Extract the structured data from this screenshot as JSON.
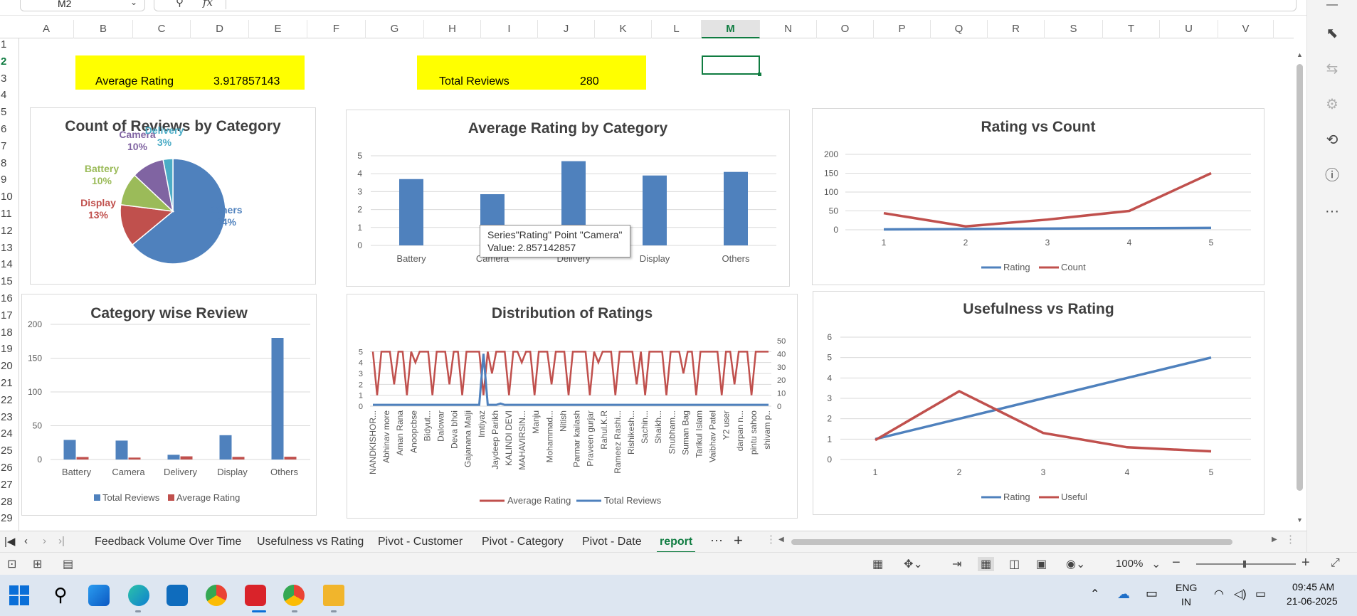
{
  "formula_bar": {
    "name_box": "M2",
    "fx_label": "fx",
    "formula": ""
  },
  "columns": [
    "A",
    "B",
    "C",
    "D",
    "E",
    "F",
    "G",
    "H",
    "I",
    "J",
    "K",
    "L",
    "M",
    "N",
    "O",
    "P",
    "Q",
    "R",
    "S",
    "T",
    "U",
    "V"
  ],
  "selected_column": "M",
  "rows": [
    "1",
    "2",
    "3",
    "4",
    "5",
    "6",
    "7",
    "8",
    "9",
    "10",
    "11",
    "12",
    "13",
    "14",
    "15",
    "16",
    "17",
    "18",
    "19",
    "20",
    "21",
    "22",
    "23",
    "24",
    "25",
    "26",
    "27",
    "28",
    "29"
  ],
  "selected_row": "2",
  "kpi": {
    "avg_rating_label": "Average Rating",
    "avg_rating_value": "3.917857143",
    "total_reviews_label": "Total Reviews",
    "total_reviews_value": "280"
  },
  "charts": {
    "pie": {
      "title": "Count of Reviews by Category",
      "labels": [
        {
          "name": "Others",
          "pct": "64%",
          "color": "#4f81bd"
        },
        {
          "name": "Display",
          "pct": "13%",
          "color": "#c0504d"
        },
        {
          "name": "Battery",
          "pct": "10%",
          "color": "#9bbb59"
        },
        {
          "name": "Camera",
          "pct": "10%",
          "color": "#8064a2"
        },
        {
          "name": "Delivery",
          "pct": "3%",
          "color": "#4bacc6"
        }
      ]
    },
    "avg_bar": {
      "title": "Average Rating by Category",
      "tooltip_line1": "Series\"Rating\" Point \"Camera\"",
      "tooltip_line2": "Value: 2.857142857"
    },
    "rating_count": {
      "title": "Rating vs Count",
      "legend": [
        "Rating",
        "Count"
      ]
    },
    "category_review": {
      "title": "Category wise Review",
      "legend": [
        "Total Reviews",
        "Average Rating"
      ]
    },
    "distribution": {
      "title": "Distribution of Ratings",
      "legend": [
        "Average Rating",
        "Total Reviews"
      ],
      "x_labels": [
        "NANDKISHOR...",
        "Abhinav more",
        "Aman Rana",
        "Anoopcbse",
        "Bidyut...",
        "Dalowar",
        "Deva bhoi",
        "Gajanana Malji",
        "Imtiyaz",
        "Jaydeep Parikh",
        "KALINDI DEVI",
        "MAHAVIRSIN...",
        "Manju",
        "Mohammad...",
        "Nitish",
        "Parmar kailash",
        "Praveen gurjar",
        "Rahul.K.R",
        "Rameez Rashi...",
        "Rishikesh...",
        "Sachin...",
        "Shaikh...",
        "Shubham...",
        "Suman Bag",
        "Tarikul Islam",
        "Vaibhav Patel",
        "Y2 user",
        "darpan n...",
        "pintu sahoo",
        "shivam p.."
      ]
    },
    "usefulness": {
      "title": "Usefulness vs Rating",
      "legend": [
        "Rating",
        "Useful"
      ]
    }
  },
  "chart_data": [
    {
      "type": "pie",
      "title": "Count of Reviews by Category",
      "categories": [
        "Others",
        "Display",
        "Battery",
        "Camera",
        "Delivery"
      ],
      "values": [
        64,
        13,
        10,
        10,
        3
      ]
    },
    {
      "type": "bar",
      "title": "Average Rating by Category",
      "categories": [
        "Battery",
        "Camera",
        "Delivery",
        "Display",
        "Others"
      ],
      "values": [
        3.7,
        2.857142857,
        4.7,
        3.9,
        4.1
      ],
      "ylim": [
        0,
        5
      ]
    },
    {
      "type": "line",
      "title": "Rating vs Count",
      "x": [
        1,
        2,
        3,
        4,
        5
      ],
      "series": [
        {
          "name": "Rating",
          "values": [
            1,
            2,
            3,
            4,
            5
          ]
        },
        {
          "name": "Count",
          "values": [
            44,
            9,
            27,
            50,
            150
          ]
        }
      ],
      "ylim": [
        0,
        200
      ]
    },
    {
      "type": "bar",
      "title": "Category wise Review",
      "categories": [
        "Battery",
        "Camera",
        "Delivery",
        "Display",
        "Others"
      ],
      "series": [
        {
          "name": "Total Reviews",
          "values": [
            29,
            28,
            7,
            36,
            180
          ]
        },
        {
          "name": "Average Rating",
          "values": [
            3.7,
            2.857142857,
            4.7,
            3.9,
            4.1
          ]
        }
      ],
      "ylim": [
        0,
        200
      ]
    },
    {
      "type": "line",
      "title": "Distribution of Ratings",
      "series": [
        {
          "name": "Average Rating",
          "values": [
            5,
            1,
            5,
            5,
            5,
            2,
            5,
            5,
            1,
            5,
            4,
            5,
            5,
            5,
            1,
            5,
            5,
            5,
            2,
            5,
            5,
            1,
            5,
            5,
            5,
            5,
            1,
            5,
            3,
            5,
            5,
            5,
            1,
            5,
            5,
            4,
            5,
            5,
            1,
            5,
            5,
            5,
            2,
            5,
            5,
            5,
            1,
            5,
            5,
            5,
            5,
            1,
            5,
            4,
            5,
            5,
            5,
            1,
            5,
            5,
            5,
            5,
            2,
            5,
            1,
            5,
            5,
            5,
            5,
            1,
            5,
            5,
            5,
            3,
            5,
            5,
            1,
            5,
            5,
            5,
            5,
            5,
            1,
            5,
            5,
            2,
            5,
            5,
            5,
            1,
            5,
            5,
            5,
            5
          ]
        },
        {
          "name": "Total Reviews",
          "values": [
            1,
            1,
            1,
            1,
            1,
            1,
            1,
            1,
            1,
            1,
            1,
            1,
            1,
            1,
            1,
            1,
            1,
            1,
            1,
            1,
            1,
            1,
            1,
            1,
            1,
            1,
            40,
            1,
            1,
            1,
            2,
            1,
            1,
            1,
            1,
            1,
            1,
            1,
            1,
            1,
            1,
            1,
            1,
            1,
            1,
            1,
            1,
            1,
            1,
            1,
            1,
            1,
            1,
            1,
            1,
            1,
            1,
            1,
            1,
            1,
            1,
            1,
            1,
            1,
            1,
            1,
            1,
            1,
            1,
            1,
            1,
            1,
            1,
            1,
            1,
            1,
            1,
            1,
            1,
            1,
            1,
            1,
            1,
            1,
            1,
            1,
            1,
            1,
            1,
            1,
            1,
            1,
            1,
            1
          ]
        }
      ],
      "ylim": [
        0,
        6
      ],
      "y2lim": [
        0,
        50
      ]
    },
    {
      "type": "line",
      "title": "Usefulness vs Rating",
      "x": [
        1,
        2,
        3,
        4,
        5
      ],
      "series": [
        {
          "name": "Rating",
          "values": [
            1,
            2,
            3,
            4,
            5
          ]
        },
        {
          "name": "Useful",
          "values": [
            0.95,
            3.35,
            1.3,
            0.6,
            0.4
          ]
        }
      ],
      "ylim": [
        0,
        6
      ]
    }
  ],
  "sheet_tabs": [
    "Feedback Volume Over Time",
    "Usefulness vs Rating",
    "Pivot - Customer",
    "Pivot - Category",
    "Pivot - Date",
    "report"
  ],
  "active_tab": "report",
  "status": {
    "zoom": "100%"
  },
  "taskbar": {
    "lang1": "ENG",
    "lang2": "IN",
    "time": "09:45 AM",
    "date": "21-06-2025"
  }
}
